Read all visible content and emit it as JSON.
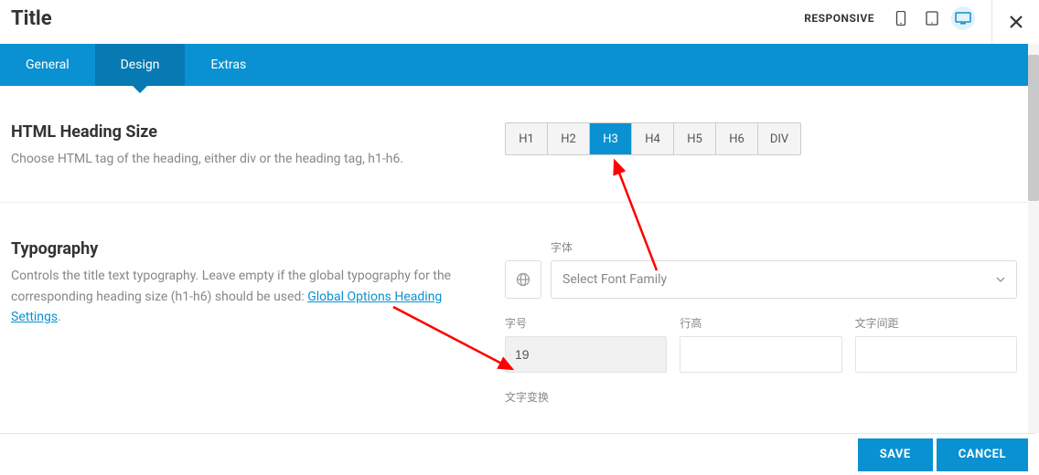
{
  "header": {
    "title": "Title",
    "responsive_label": "RESPONSIVE"
  },
  "tabs": {
    "general": "General",
    "design": "Design",
    "extras": "Extras"
  },
  "heading_section": {
    "title": "HTML Heading Size",
    "desc": "Choose HTML tag of the heading, either div or the heading tag, h1-h6.",
    "options": {
      "h1": "H1",
      "h2": "H2",
      "h3": "H3",
      "h4": "H4",
      "h5": "H5",
      "h6": "H6",
      "div": "DIV"
    }
  },
  "typography_section": {
    "title": "Typography",
    "desc_prefix": "Controls the title text typography. Leave empty if the global typography for the corresponding heading size (h1-h6) should be used: ",
    "desc_link": "Global Options Heading Settings",
    "desc_suffix": ".",
    "font_label": "字体",
    "font_placeholder": "Select Font Family",
    "size_label": "字号",
    "size_value": "19",
    "lineheight_label": "行高",
    "letterspacing_label": "文字间距",
    "transform_label": "文字变换"
  },
  "footer": {
    "save": "SAVE",
    "cancel": "CANCEL"
  }
}
